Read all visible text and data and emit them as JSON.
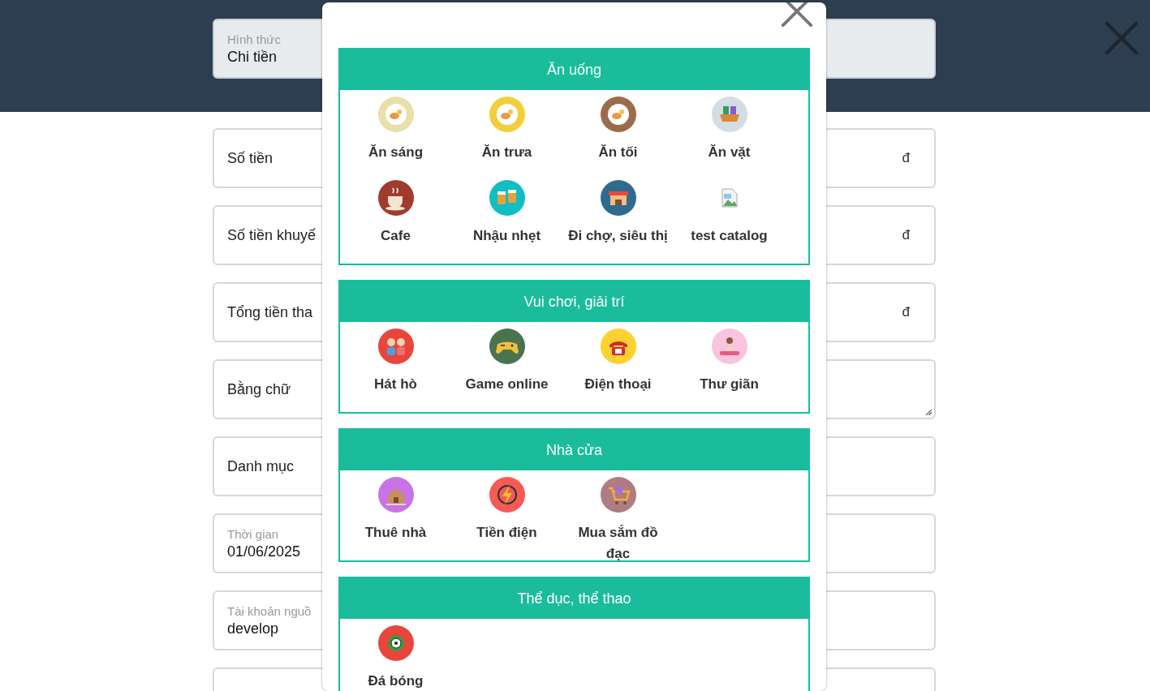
{
  "header": {
    "field": {
      "label": "Hình thức",
      "value": "Chi tiền",
      "disabled": true
    }
  },
  "form": {
    "fields": [
      {
        "kind": "input",
        "label": "Số tiền",
        "suffix": "đ"
      },
      {
        "kind": "input",
        "label": "Số tiền khuyế",
        "suffix": "đ"
      },
      {
        "kind": "input",
        "label": "Tổng tiền tha",
        "suffix": "đ"
      },
      {
        "kind": "textarea",
        "label": "Bằng chữ"
      },
      {
        "kind": "input",
        "label": "Danh mục"
      },
      {
        "kind": "floating",
        "label": "Thời gian",
        "value": "01/06/2025"
      },
      {
        "kind": "floating",
        "label": "Tài khoản nguồ",
        "value": "develop"
      },
      {
        "kind": "input"
      }
    ]
  },
  "category_dialog": {
    "groups": [
      {
        "title": "Ăn uống",
        "items": [
          {
            "label": "Ăn sáng",
            "kind": "plate",
            "color": "#e8e0a8"
          },
          {
            "label": "Ăn trưa",
            "kind": "plate",
            "color": "#f2cf3a"
          },
          {
            "label": "Ăn tối",
            "kind": "plate",
            "color": "#9c6b4a"
          },
          {
            "label": "Ăn vặt",
            "kind": "basket",
            "color": "#d3dde3"
          },
          {
            "label": "Cafe",
            "kind": "cup",
            "color": "#a03c2e"
          },
          {
            "label": "Nhậu nhẹt",
            "kind": "mugs",
            "color": "#12bdc4"
          },
          {
            "label": "Đi chợ, siêu thị",
            "kind": "shop",
            "color": "#2f6b8e"
          },
          {
            "label": "test catalog",
            "kind": "broken-image",
            "color": "#ffffff"
          }
        ]
      },
      {
        "title": "Vui chơi, giải trí",
        "items": [
          {
            "label": "Hát hò",
            "kind": "people",
            "color": "#e8453c"
          },
          {
            "label": "Game online",
            "kind": "gamepad",
            "color": "#4a7350"
          },
          {
            "label": "Điện thoại",
            "kind": "phone",
            "color": "#fdd132"
          },
          {
            "label": "Thư giãn",
            "kind": "person",
            "color": "#f9c4e0"
          }
        ]
      },
      {
        "title": "Nhà cửa",
        "items": [
          {
            "label": "Thuê nhà",
            "kind": "house",
            "color": "#c873e6"
          },
          {
            "label": "Tiền điện",
            "kind": "bolt",
            "color": "#f55a55"
          },
          {
            "label": "Mua sắm đồ đạc",
            "kind": "cart",
            "color": "#b07b82"
          }
        ]
      },
      {
        "title": "Thể dục, thể thao",
        "items": [
          {
            "label": "Đá bóng",
            "kind": "ball",
            "color": "#e8453c"
          }
        ]
      }
    ]
  }
}
